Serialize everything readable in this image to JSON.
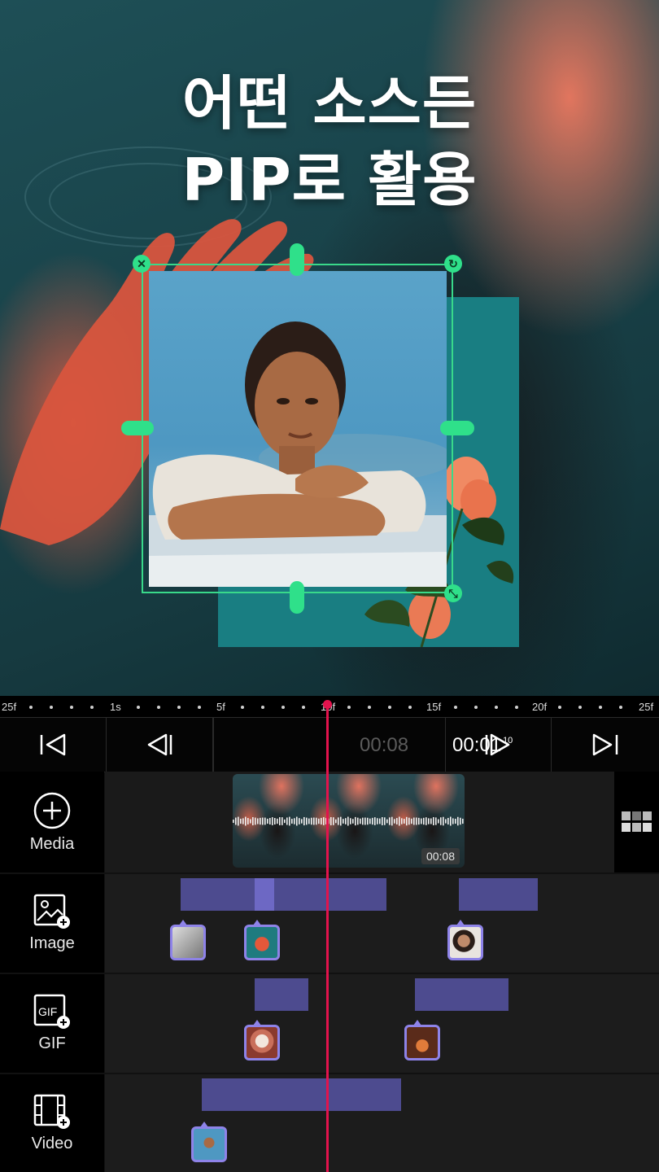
{
  "headline": {
    "line1": "어떤 소스든",
    "line2": "PIP로 활용"
  },
  "ruler": {
    "labels": [
      {
        "id": "r0",
        "text": "25f"
      },
      {
        "id": "r1",
        "text": "1s"
      },
      {
        "id": "r2",
        "text": "5f"
      },
      {
        "id": "r3",
        "text": "10f"
      },
      {
        "id": "r4",
        "text": "15f"
      },
      {
        "id": "r5",
        "text": "20f"
      },
      {
        "id": "r6",
        "text": "25f"
      }
    ]
  },
  "transport": {
    "current_time": "00:01",
    "current_frames": "10",
    "total_time": "00:08"
  },
  "tracks": {
    "media": {
      "label": "Media",
      "clip_duration": "00:08"
    },
    "image": {
      "label": "Image"
    },
    "gif": {
      "label": "GIF",
      "icon_text": "GIF"
    },
    "video": {
      "label": "Video"
    }
  },
  "colors": {
    "selection": "#2fe08a",
    "playhead": "#e3134d",
    "layer_bar": "#4d4b8f",
    "layer_chip_border": "#8e83e8",
    "teal_card": "#197e82"
  }
}
